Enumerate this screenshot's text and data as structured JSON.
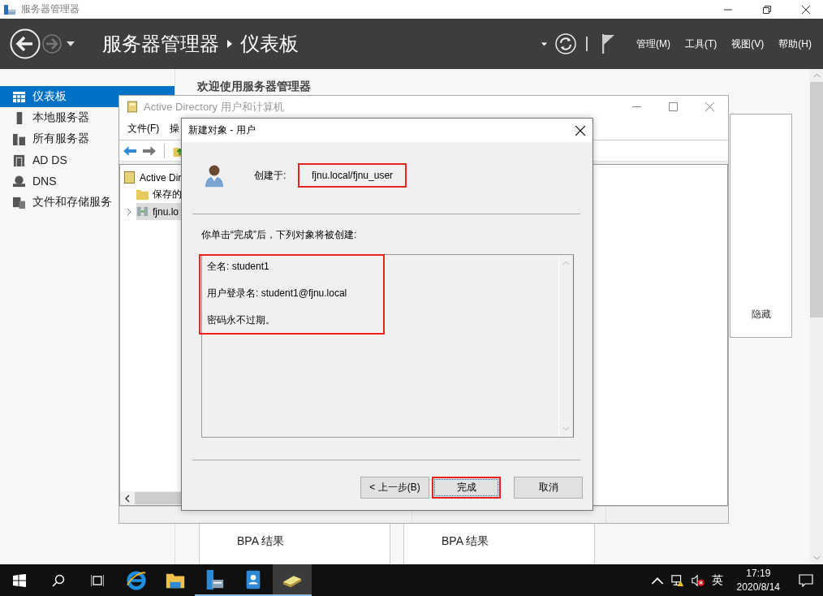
{
  "window": {
    "title": "服务器管理器"
  },
  "header": {
    "breadcrumb": [
      "服务器管理器",
      "仪表板"
    ],
    "menus": [
      "管理(M)",
      "工具(T)",
      "视图(V)",
      "帮助(H)"
    ]
  },
  "sidebar": {
    "items": [
      {
        "label": "仪表板",
        "kind": "dashboard",
        "selected": true
      },
      {
        "label": "本地服务器",
        "kind": "server",
        "selected": false
      },
      {
        "label": "所有服务器",
        "kind": "servers",
        "selected": false
      },
      {
        "label": "AD DS",
        "kind": "adds",
        "selected": false
      },
      {
        "label": "DNS",
        "kind": "dns",
        "selected": false
      },
      {
        "label": "文件和存储服务",
        "kind": "files",
        "selected": false
      }
    ]
  },
  "dashboard": {
    "welcome": "欢迎使用服务器管理器",
    "hide_label": "隐藏",
    "tiles": [
      {
        "lines": [
          "BPA 结果"
        ]
      },
      {
        "lines": [
          "BPA 结果"
        ]
      }
    ]
  },
  "ad_window": {
    "title": "Active Directory 用户和计算机",
    "menus": [
      "文件(F)",
      "操"
    ],
    "tree": [
      {
        "label": "Active Dir",
        "kind": "root",
        "selected": false,
        "children": [
          {
            "label": "保存的",
            "kind": "folder",
            "expandable": false,
            "selected": false
          },
          {
            "label": "fjnu.lo",
            "kind": "domain",
            "expandable": true,
            "selected": true
          }
        ]
      }
    ]
  },
  "dialog": {
    "title": "新建对象 - 用户",
    "created_in_label": "创建于:",
    "created_in": "fjnu.local/fjnu_user",
    "created_in_highlighted": true,
    "intro": "你单击“完成”后，下列对象将被创建:",
    "summary": [
      "全名: student1",
      "用户登录名: student1@fjnu.local",
      "密码永不过期。"
    ],
    "summary_highlighted": true,
    "buttons": [
      {
        "label": "< 上一步(B)",
        "highlighted": false
      },
      {
        "label": "完成",
        "highlighted": true
      },
      {
        "label": "取消",
        "highlighted": false
      }
    ]
  },
  "taskbar": {
    "apps": [
      {
        "kind": "ie",
        "running": false,
        "active": false
      },
      {
        "kind": "explorer",
        "running": false,
        "active": false
      },
      {
        "kind": "server-manager",
        "running": true,
        "active": false
      },
      {
        "kind": "contacts",
        "running": true,
        "active": false
      },
      {
        "kind": "ad",
        "running": true,
        "active": true
      }
    ],
    "ime": "英",
    "time": "17:19",
    "date": "2020/8/14"
  }
}
